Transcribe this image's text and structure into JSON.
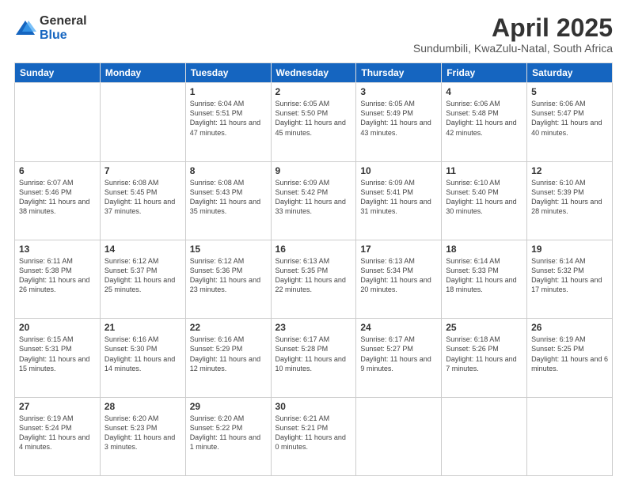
{
  "logo": {
    "general": "General",
    "blue": "Blue"
  },
  "title": "April 2025",
  "subtitle": "Sundumbili, KwaZulu-Natal, South Africa",
  "days_of_week": [
    "Sunday",
    "Monday",
    "Tuesday",
    "Wednesday",
    "Thursday",
    "Friday",
    "Saturday"
  ],
  "weeks": [
    [
      {
        "day": "",
        "sunrise": "",
        "sunset": "",
        "daylight": ""
      },
      {
        "day": "",
        "sunrise": "",
        "sunset": "",
        "daylight": ""
      },
      {
        "day": "1",
        "sunrise": "Sunrise: 6:04 AM",
        "sunset": "Sunset: 5:51 PM",
        "daylight": "Daylight: 11 hours and 47 minutes."
      },
      {
        "day": "2",
        "sunrise": "Sunrise: 6:05 AM",
        "sunset": "Sunset: 5:50 PM",
        "daylight": "Daylight: 11 hours and 45 minutes."
      },
      {
        "day": "3",
        "sunrise": "Sunrise: 6:05 AM",
        "sunset": "Sunset: 5:49 PM",
        "daylight": "Daylight: 11 hours and 43 minutes."
      },
      {
        "day": "4",
        "sunrise": "Sunrise: 6:06 AM",
        "sunset": "Sunset: 5:48 PM",
        "daylight": "Daylight: 11 hours and 42 minutes."
      },
      {
        "day": "5",
        "sunrise": "Sunrise: 6:06 AM",
        "sunset": "Sunset: 5:47 PM",
        "daylight": "Daylight: 11 hours and 40 minutes."
      }
    ],
    [
      {
        "day": "6",
        "sunrise": "Sunrise: 6:07 AM",
        "sunset": "Sunset: 5:46 PM",
        "daylight": "Daylight: 11 hours and 38 minutes."
      },
      {
        "day": "7",
        "sunrise": "Sunrise: 6:08 AM",
        "sunset": "Sunset: 5:45 PM",
        "daylight": "Daylight: 11 hours and 37 minutes."
      },
      {
        "day": "8",
        "sunrise": "Sunrise: 6:08 AM",
        "sunset": "Sunset: 5:43 PM",
        "daylight": "Daylight: 11 hours and 35 minutes."
      },
      {
        "day": "9",
        "sunrise": "Sunrise: 6:09 AM",
        "sunset": "Sunset: 5:42 PM",
        "daylight": "Daylight: 11 hours and 33 minutes."
      },
      {
        "day": "10",
        "sunrise": "Sunrise: 6:09 AM",
        "sunset": "Sunset: 5:41 PM",
        "daylight": "Daylight: 11 hours and 31 minutes."
      },
      {
        "day": "11",
        "sunrise": "Sunrise: 6:10 AM",
        "sunset": "Sunset: 5:40 PM",
        "daylight": "Daylight: 11 hours and 30 minutes."
      },
      {
        "day": "12",
        "sunrise": "Sunrise: 6:10 AM",
        "sunset": "Sunset: 5:39 PM",
        "daylight": "Daylight: 11 hours and 28 minutes."
      }
    ],
    [
      {
        "day": "13",
        "sunrise": "Sunrise: 6:11 AM",
        "sunset": "Sunset: 5:38 PM",
        "daylight": "Daylight: 11 hours and 26 minutes."
      },
      {
        "day": "14",
        "sunrise": "Sunrise: 6:12 AM",
        "sunset": "Sunset: 5:37 PM",
        "daylight": "Daylight: 11 hours and 25 minutes."
      },
      {
        "day": "15",
        "sunrise": "Sunrise: 6:12 AM",
        "sunset": "Sunset: 5:36 PM",
        "daylight": "Daylight: 11 hours and 23 minutes."
      },
      {
        "day": "16",
        "sunrise": "Sunrise: 6:13 AM",
        "sunset": "Sunset: 5:35 PM",
        "daylight": "Daylight: 11 hours and 22 minutes."
      },
      {
        "day": "17",
        "sunrise": "Sunrise: 6:13 AM",
        "sunset": "Sunset: 5:34 PM",
        "daylight": "Daylight: 11 hours and 20 minutes."
      },
      {
        "day": "18",
        "sunrise": "Sunrise: 6:14 AM",
        "sunset": "Sunset: 5:33 PM",
        "daylight": "Daylight: 11 hours and 18 minutes."
      },
      {
        "day": "19",
        "sunrise": "Sunrise: 6:14 AM",
        "sunset": "Sunset: 5:32 PM",
        "daylight": "Daylight: 11 hours and 17 minutes."
      }
    ],
    [
      {
        "day": "20",
        "sunrise": "Sunrise: 6:15 AM",
        "sunset": "Sunset: 5:31 PM",
        "daylight": "Daylight: 11 hours and 15 minutes."
      },
      {
        "day": "21",
        "sunrise": "Sunrise: 6:16 AM",
        "sunset": "Sunset: 5:30 PM",
        "daylight": "Daylight: 11 hours and 14 minutes."
      },
      {
        "day": "22",
        "sunrise": "Sunrise: 6:16 AM",
        "sunset": "Sunset: 5:29 PM",
        "daylight": "Daylight: 11 hours and 12 minutes."
      },
      {
        "day": "23",
        "sunrise": "Sunrise: 6:17 AM",
        "sunset": "Sunset: 5:28 PM",
        "daylight": "Daylight: 11 hours and 10 minutes."
      },
      {
        "day": "24",
        "sunrise": "Sunrise: 6:17 AM",
        "sunset": "Sunset: 5:27 PM",
        "daylight": "Daylight: 11 hours and 9 minutes."
      },
      {
        "day": "25",
        "sunrise": "Sunrise: 6:18 AM",
        "sunset": "Sunset: 5:26 PM",
        "daylight": "Daylight: 11 hours and 7 minutes."
      },
      {
        "day": "26",
        "sunrise": "Sunrise: 6:19 AM",
        "sunset": "Sunset: 5:25 PM",
        "daylight": "Daylight: 11 hours and 6 minutes."
      }
    ],
    [
      {
        "day": "27",
        "sunrise": "Sunrise: 6:19 AM",
        "sunset": "Sunset: 5:24 PM",
        "daylight": "Daylight: 11 hours and 4 minutes."
      },
      {
        "day": "28",
        "sunrise": "Sunrise: 6:20 AM",
        "sunset": "Sunset: 5:23 PM",
        "daylight": "Daylight: 11 hours and 3 minutes."
      },
      {
        "day": "29",
        "sunrise": "Sunrise: 6:20 AM",
        "sunset": "Sunset: 5:22 PM",
        "daylight": "Daylight: 11 hours and 1 minute."
      },
      {
        "day": "30",
        "sunrise": "Sunrise: 6:21 AM",
        "sunset": "Sunset: 5:21 PM",
        "daylight": "Daylight: 11 hours and 0 minutes."
      },
      {
        "day": "",
        "sunrise": "",
        "sunset": "",
        "daylight": ""
      },
      {
        "day": "",
        "sunrise": "",
        "sunset": "",
        "daylight": ""
      },
      {
        "day": "",
        "sunrise": "",
        "sunset": "",
        "daylight": ""
      }
    ]
  ]
}
